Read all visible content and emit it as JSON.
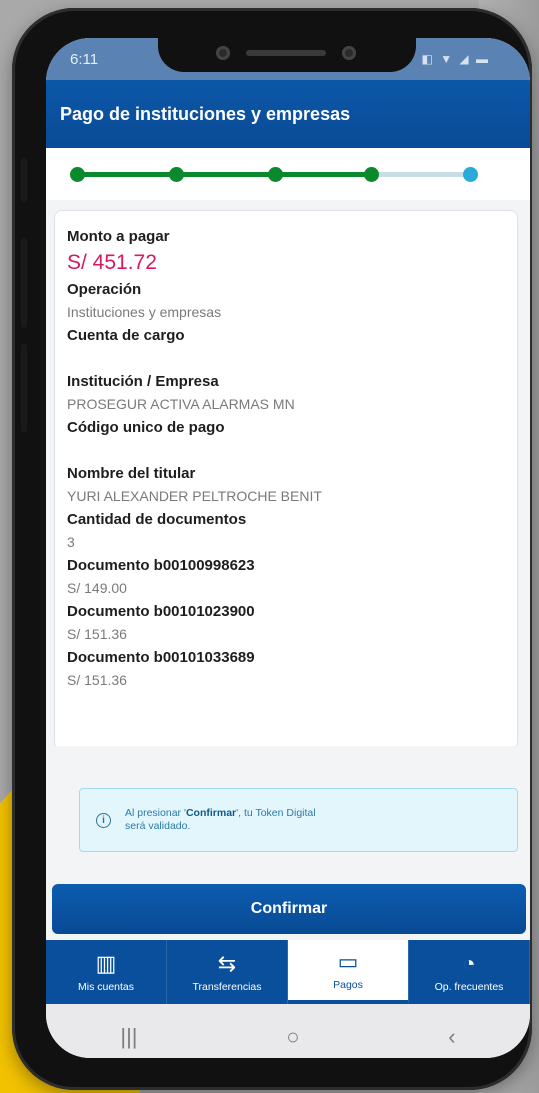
{
  "status_bar": {
    "time": "6:11",
    "icons": "◧ ▼ ◢ ▬"
  },
  "header": {
    "title": "Pago de instituciones y empresas"
  },
  "stepper": {
    "total_steps": 5,
    "completed_steps": 4
  },
  "details": {
    "monto_label": "Monto a pagar",
    "monto_value": "S/ 451.72",
    "operacion_label": "Operación",
    "operacion_value": "Instituciones y empresas",
    "cuenta_label": "Cuenta de cargo",
    "institucion_label": "Institución / Empresa",
    "institucion_value": "PROSEGUR ACTIVA ALARMAS MN",
    "codigo_label": "Código unico de pago",
    "titular_label": "Nombre del titular",
    "titular_value": "YURI ALEXANDER PELTROCHE BENIT",
    "cantidad_label": "Cantidad de documentos",
    "cantidad_value": "3",
    "documents": [
      {
        "label": "Documento b00100998623",
        "amount": "S/ 149.00"
      },
      {
        "label": "Documento b00101023900",
        "amount": "S/ 151.36"
      },
      {
        "label": "Documento b00101033689",
        "amount": "S/ 151.36"
      }
    ]
  },
  "notice": {
    "icon": "info-icon",
    "prefix": "Al presionar '",
    "emphasis": "Confirmar",
    "suffix": "', tu Token Digital será validado."
  },
  "confirm_button": {
    "label": "Confirmar"
  },
  "nav": [
    {
      "label": "Mis cuentas",
      "icon": "bar-chart-icon",
      "glyph": "▥"
    },
    {
      "label": "Transferencias",
      "icon": "transfer-arrows-icon",
      "glyph": "⇆"
    },
    {
      "label": "Pagos",
      "icon": "card-payment-icon",
      "glyph": "▭"
    },
    {
      "label": "Op. frecuentes",
      "icon": "clock-money-icon",
      "glyph": "◔"
    }
  ],
  "active_nav": "Pagos",
  "system_nav": {
    "recents": "|||",
    "home": "○",
    "back": "‹"
  },
  "colors": {
    "primary": "#0a4f9c",
    "amount": "#d9185f",
    "step_done": "#0a8a2c",
    "step_todo": "#2aaad8",
    "notice_bg": "#e3f6fc"
  }
}
